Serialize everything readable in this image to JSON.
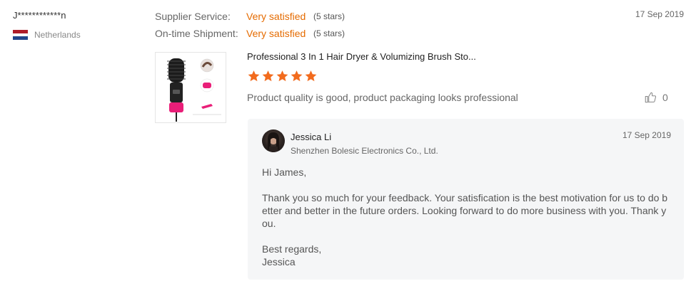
{
  "buyer": {
    "name": "J************n",
    "country": "Netherlands",
    "flag_colors": [
      "#ae1c28",
      "#ffffff",
      "#21468b"
    ]
  },
  "ratings": [
    {
      "label": "Supplier Service:",
      "value": "Very satisfied",
      "stars_text": "(5 stars)"
    },
    {
      "label": "On-time Shipment:",
      "value": "Very satisfied",
      "stars_text": "(5 stars)"
    }
  ],
  "review": {
    "date": "17 Sep 2019",
    "product_title": "Professional 3 In 1 Hair Dryer & Volumizing Brush Sto...",
    "star_rating": 5,
    "star_color": "#f26b1d",
    "text": "Product quality is good, product packaging looks professional",
    "likes": "0",
    "like_icon": "thumbs-up-icon",
    "accent_color": "#e56b00"
  },
  "reply": {
    "seller_name": "Jessica Li",
    "company": "Shenzhen Bolesic Electronics Co., Ltd.",
    "date": "17 Sep 2019",
    "greeting": "Hi James,",
    "body": "Thank you so much for your feedback.  Your satisfication is the best motivation for us to do better and better in the future orders.  Looking forward to do more business with you. Thank you.",
    "closing": "Best regards,",
    "signature": "Jessica"
  }
}
